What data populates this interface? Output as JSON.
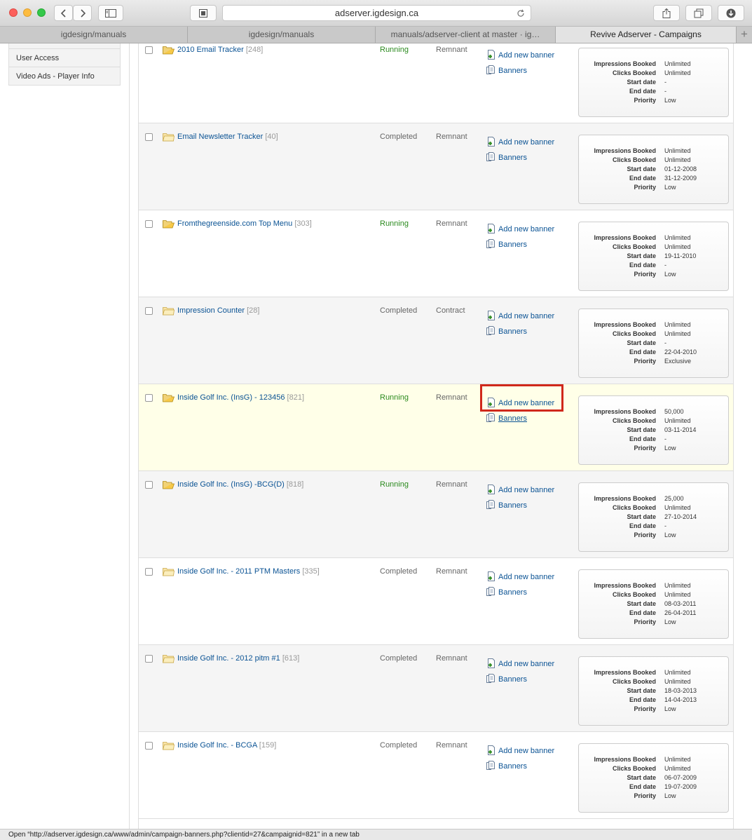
{
  "browser": {
    "url": "adserver.igdesign.ca",
    "tabs": [
      {
        "label": "igdesign/manuals",
        "active": false
      },
      {
        "label": "igdesign/manuals",
        "active": false
      },
      {
        "label": "manuals/adserver-client at master · ig…",
        "active": false
      },
      {
        "label": "Revive Adserver - Campaigns",
        "active": true
      }
    ],
    "new_tab": "+"
  },
  "sidebar": {
    "items": [
      {
        "label": "User Access"
      },
      {
        "label": "Video Ads - Player Info"
      }
    ]
  },
  "labels": {
    "add_banner": "Add new banner",
    "banners": "Banners",
    "impressions_booked": "Impressions Booked",
    "clicks_booked": "Clicks Booked",
    "start_date": "Start date",
    "end_date": "End date",
    "priority": "Priority"
  },
  "campaigns": [
    {
      "name": "2010 Email Tracker",
      "id": "[248]",
      "status": "Running",
      "type": "Remnant",
      "folder": "open",
      "impressions": "Unlimited",
      "clicks": "Unlimited",
      "start": "-",
      "end": "-",
      "priority": "Low"
    },
    {
      "name": "Email Newsletter Tracker",
      "id": "[40]",
      "status": "Completed",
      "type": "Remnant",
      "folder": "closed",
      "impressions": "Unlimited",
      "clicks": "Unlimited",
      "start": "01-12-2008",
      "end": "31-12-2009",
      "priority": "Low"
    },
    {
      "name": "Fromthegreenside.com Top Menu",
      "id": "[303]",
      "status": "Running",
      "type": "Remnant",
      "folder": "open",
      "impressions": "Unlimited",
      "clicks": "Unlimited",
      "start": "19-11-2010",
      "end": "-",
      "priority": "Low"
    },
    {
      "name": "Impression Counter",
      "id": "[28]",
      "status": "Completed",
      "type": "Contract",
      "folder": "closed",
      "impressions": "Unlimited",
      "clicks": "Unlimited",
      "start": "-",
      "end": "22-04-2010",
      "priority": "Exclusive"
    },
    {
      "name": "Inside Golf Inc. (InsG) - 123456",
      "id": "[821]",
      "status": "Running",
      "type": "Remnant",
      "folder": "open",
      "impressions": "50,000",
      "clicks": "Unlimited",
      "start": "03-11-2014",
      "end": "-",
      "priority": "Low",
      "highlighted": true
    },
    {
      "name": "Inside Golf Inc. (InsG) -BCG(D)",
      "id": "[818]",
      "status": "Running",
      "type": "Remnant",
      "folder": "open",
      "impressions": "25,000",
      "clicks": "Unlimited",
      "start": "27-10-2014",
      "end": "-",
      "priority": "Low"
    },
    {
      "name": "Inside Golf Inc. - 2011 PTM Masters",
      "id": "[335]",
      "status": "Completed",
      "type": "Remnant",
      "folder": "closed",
      "impressions": "Unlimited",
      "clicks": "Unlimited",
      "start": "08-03-2011",
      "end": "26-04-2011",
      "priority": "Low"
    },
    {
      "name": "Inside Golf Inc. - 2012 pitm #1",
      "id": "[613]",
      "status": "Completed",
      "type": "Remnant",
      "folder": "closed",
      "impressions": "Unlimited",
      "clicks": "Unlimited",
      "start": "18-03-2013",
      "end": "14-04-2013",
      "priority": "Low"
    },
    {
      "name": "Inside Golf Inc. - BCGA",
      "id": "[159]",
      "status": "Completed",
      "type": "Remnant",
      "folder": "closed",
      "impressions": "Unlimited",
      "clicks": "Unlimited",
      "start": "06-07-2009",
      "end": "19-07-2009",
      "priority": "Low"
    }
  ],
  "status_bar": "Open “http://adserver.igdesign.ca/www/admin/campaign-banners.php?clientid=27&campaignid=821” in a new tab",
  "colors": {
    "running": "#2b8a1e",
    "link": "#0b5394",
    "highlight_box": "#d0281b",
    "highlight_row": "#ffffe8"
  }
}
